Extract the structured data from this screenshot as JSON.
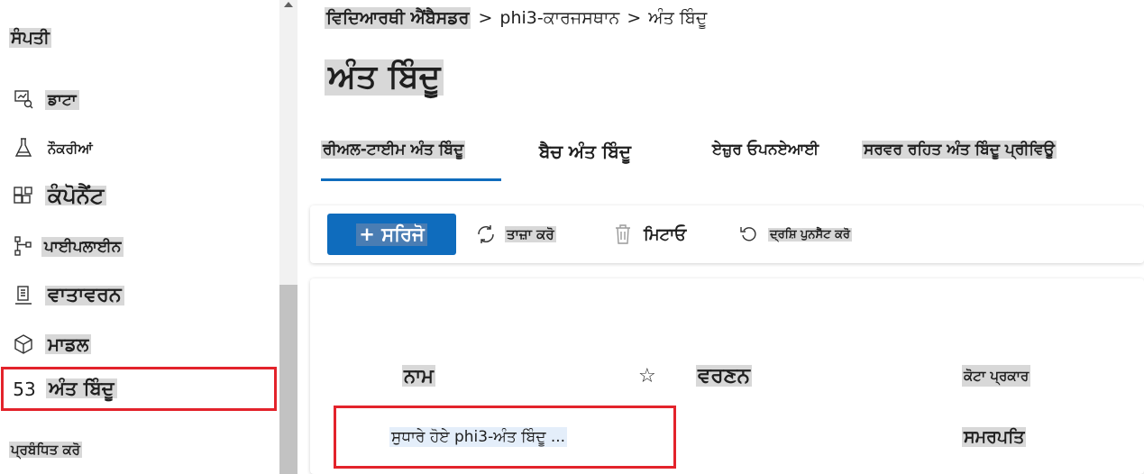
{
  "sidebar": {
    "header": "ਸੰਪਤੀ",
    "items": [
      {
        "label": "ਡਾਟਾ",
        "icon": "data-icon"
      },
      {
        "label": "ਨੌਕਰੀਆਂ",
        "icon": "flask-icon"
      },
      {
        "label": "ਕੰਪੋਨੈਂਟ",
        "icon": "components-icon"
      },
      {
        "label": "ਪਾਈਪਲਾਈਨ",
        "icon": "pipeline-icon"
      },
      {
        "label": "ਵਾਤਾਵਰਨ",
        "icon": "environment-icon"
      },
      {
        "label": "ਮਾਡਲ",
        "icon": "cube-icon"
      },
      {
        "label": "ਅੰਤ ਬਿੰਦੂ",
        "icon": "endpoints-icon",
        "icon_text": "53"
      }
    ],
    "footer": "ਪ੍ਰਬੰਧਿਤ ਕਰੋ"
  },
  "breadcrumb": {
    "items": [
      "ਵਿਦਿਆਰਥੀ ਐਂਬੈਸਡਰ",
      "phi3-ਕਾਰਜਸਥਾਨ",
      "ਅੰਤ ਬਿੰਦੂ"
    ],
    "separator": ">"
  },
  "page_title": "ਅੰਤ ਬਿੰਦੂ",
  "tabs": [
    {
      "label": "ਰੀਅਲ-ਟਾਈਮ ਅੰਤ ਬਿੰਦੂ",
      "active": true
    },
    {
      "label": "ਬੈਚ ਅੰਤ ਬਿੰਦੂ",
      "active": false
    },
    {
      "label": "ਏਜ਼ੁਰ ਓਪਨਏਆਈ",
      "active": false
    },
    {
      "label": "ਸਰਵਰ ਰਹਿਤ ਅੰਤ ਬਿੰਦੂ ਪ੍ਰੀਵਿਊ",
      "active": false
    }
  ],
  "toolbar": {
    "create_label": "+ ਸਰਿਜੋ",
    "refresh_label": "ਤਾਜ਼ਾ ਕਰੋ",
    "delete_label": "ਮਿਟਾਓ",
    "reset_view_label": "ਦ੍ਰਸ਼ਿ ਪੁਨਸੈੱਟ ਕਰੋ"
  },
  "table": {
    "columns": [
      "ਨਾਮ",
      "ਵਰਣਨ",
      "ਕੋਟਾ ਪ੍ਰਕਾਰ"
    ],
    "rows": [
      {
        "name": "ਸੁਧਾਰੇ ਹੋਏ phi3-ਅੰਤ ਬਿੰਦੂ ...",
        "description": "",
        "quota_type": "ਸਮਰਪਤਿ"
      }
    ]
  },
  "colors": {
    "accent": "#0f6cbd",
    "highlight_border": "#e3232b",
    "text_highlight": "#d8d8d8"
  }
}
